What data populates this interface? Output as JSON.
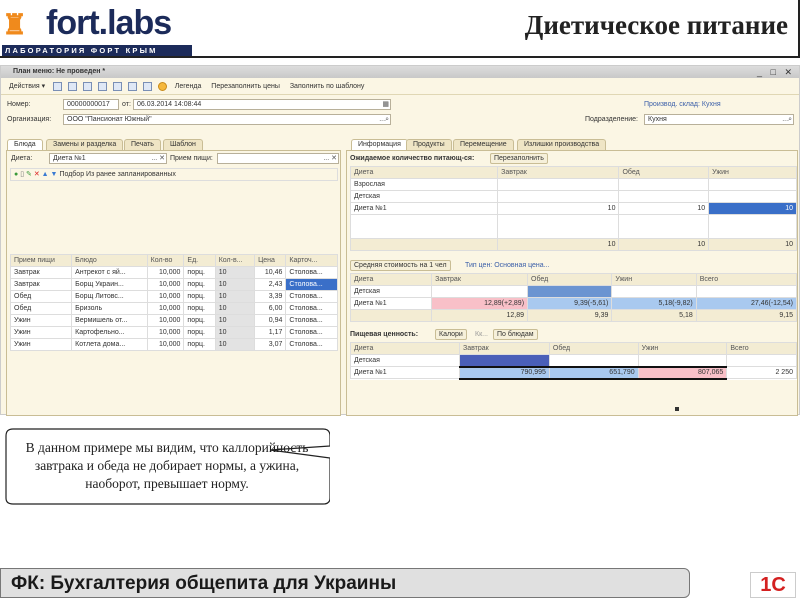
{
  "header": {
    "logo_brand": "fort.labs",
    "logo_sub": "ЛАБОРАТОРИЯ ФОРТ КРЫМ",
    "title": "Диетическое питание"
  },
  "window": {
    "title": "План меню: Не проведен *",
    "controls": "_ □ ✕",
    "toolbar": {
      "actions": "Действия ▾",
      "legend": "Легенда",
      "refill_prices": "Перезаполнить цены",
      "fill_template": "Заполнить по шаблону"
    },
    "form": {
      "number_label": "Номер:",
      "number": "00000000017",
      "from_label": "от:",
      "date": "06.03.2014 14:08:44",
      "org_label": "Организация:",
      "org": "ООО \"Пансионат Южный\"",
      "warehouse_link": "Производ. склад: Кухня",
      "dept_label": "Подразделение:",
      "dept": "Кухня"
    },
    "left_tabs": [
      "Блюда",
      "Замены и разделка",
      "Печать",
      "Шаблон"
    ],
    "diet_label": "Диета:",
    "diet": "Диета №1",
    "meal_label": "Прием пищи:",
    "meal": "",
    "sub_toolbar": {
      "pick": "Подбор",
      "from_planned": "Из ранее запланированных"
    },
    "dishes": {
      "headers": [
        "Прием пищи",
        "Блюдо",
        "Кол-во",
        "Ед.",
        "Кол-в...",
        "Цена",
        "Карточ..."
      ],
      "rows": [
        [
          "Завтрак",
          "Антрекот с яй...",
          "10,000",
          "порц.",
          "10",
          "10,46",
          "Столова..."
        ],
        [
          "Завтрак",
          "Борщ Украин...",
          "10,000",
          "порц.",
          "10",
          "2,43",
          "Столова..."
        ],
        [
          "Обед",
          "Борщ Литовс...",
          "10,000",
          "порц.",
          "10",
          "3,39",
          "Столова..."
        ],
        [
          "Обед",
          "Бризоль",
          "10,000",
          "порц.",
          "10",
          "6,00",
          "Столова..."
        ],
        [
          "Ужин",
          "Вермишель от...",
          "10,000",
          "порц.",
          "10",
          "0,94",
          "Столова..."
        ],
        [
          "Ужин",
          "Картофельно...",
          "10,000",
          "порц.",
          "10",
          "1,17",
          "Столова..."
        ],
        [
          "Ужин",
          "Котлета дома...",
          "10,000",
          "порц.",
          "10",
          "3,07",
          "Столова..."
        ]
      ]
    },
    "right_tabs": [
      "Информация",
      "Продукты",
      "Перемещение",
      "Излишки производства"
    ],
    "expected": {
      "label": "Ожидаемое количество питающ-ся:",
      "refill": "Перезаполнить",
      "headers": [
        "Диета",
        "Завтрак",
        "Обед",
        "Ужин"
      ],
      "rows": [
        [
          "Взрослая",
          "",
          "",
          ""
        ],
        [
          "Детская",
          "",
          "",
          ""
        ],
        [
          "Диета №1",
          "10",
          "10",
          "10"
        ],
        [
          "",
          "",
          "",
          ""
        ]
      ],
      "totals": [
        "",
        "10",
        "10",
        "10"
      ]
    },
    "avg_cost": {
      "label": "Средняя стоимость на 1 чел",
      "price_type": "Тип цен: Основная цена...",
      "headers": [
        "Диета",
        "Завтрак",
        "Обед",
        "Ужин",
        "Всего"
      ],
      "rows": [
        [
          "Детская",
          "",
          "",
          "",
          ""
        ],
        [
          "Диета №1",
          "12,89(+2,89)",
          "9,39(-5,61)",
          "5,18(-9,82)",
          "27,46(-12,54)"
        ]
      ],
      "totals": [
        "",
        "12,89",
        "9,39",
        "5,18",
        "9,15"
      ]
    },
    "nutrition": {
      "label": "Пищевая ценность:",
      "calories": "Калори",
      "kk": "Кк...",
      "by_dish": "По блюдам",
      "headers": [
        "Диета",
        "Завтрак",
        "Обед",
        "Ужин",
        "Всего"
      ],
      "rows": [
        [
          "Детская",
          "",
          "",
          "",
          ""
        ],
        [
          "Диета №1",
          "790,995",
          "651,790",
          "807,065",
          "2 250"
        ]
      ]
    }
  },
  "callout": "В данном примере мы видим, что каллорийность завтрака и обеда не добирает нормы, а ужина, наоборот, превышает норму.",
  "footer": {
    "title": "ФК: Бухгалтерия общепита для Украины",
    "logo": "1С"
  }
}
